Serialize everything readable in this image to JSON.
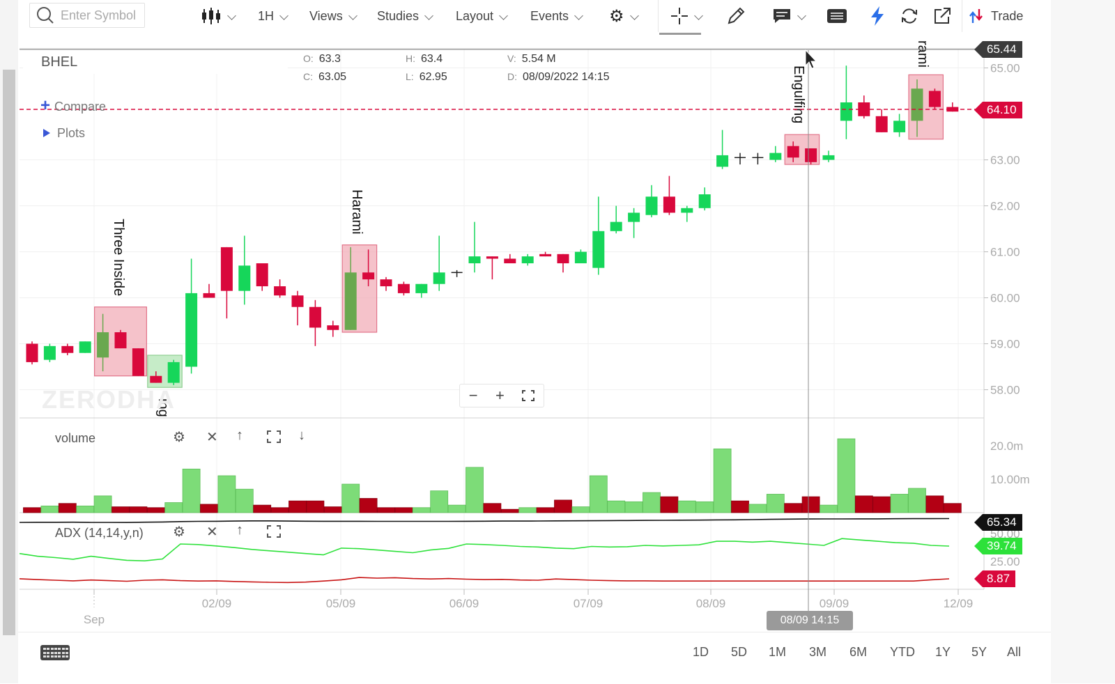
{
  "toolbar": {
    "search_placeholder": "Enter Symbol",
    "interval": "1H",
    "views": "Views",
    "studies": "Studies",
    "layout": "Layout",
    "events": "Events",
    "trade": "Trade"
  },
  "legend": {
    "symbol": "BHEL",
    "o_label": "O:",
    "o": "63.3",
    "h_label": "H:",
    "h": "63.4",
    "v_label": "V:",
    "v": "5.54 M",
    "c_label": "C:",
    "c": "63.05",
    "l_label": "L:",
    "l": "62.95",
    "d_label": "D:",
    "d": "08/09/2022 14:15",
    "compare": "Compare",
    "plots": "Plots"
  },
  "watermark": "ZERODHA",
  "panels": {
    "volume_label": "volume",
    "adx_label": "ADX (14,14,y,n)"
  },
  "price_tags": {
    "crosshair_price": "65.44",
    "last_price": "64.10",
    "adx_black": "65.34",
    "adx_green": "39.74",
    "adx_red": "8.87"
  },
  "crosshair_time": "08/09 14:15",
  "range_buttons": [
    "1D",
    "5D",
    "1M",
    "3M",
    "6M",
    "YTD",
    "1Y",
    "5Y",
    "All"
  ],
  "colors": {
    "up": "#16d65a",
    "down": "#d9083c",
    "vol_up": "#7ddc78",
    "vol_down": "#b30014",
    "adx_black": "#111111",
    "adx_green": "#2de13a",
    "adx_red": "#c81313",
    "pattern_fill": "#f2aeb8",
    "pattern_fill_green": "#b3e6b5"
  },
  "chart_data": {
    "type": "candlestick",
    "ylim": [
      57.5,
      65.6
    ],
    "y_ticks": [
      "65.00",
      "63.00",
      "62.00",
      "61.00",
      "60.00",
      "59.00",
      "58.00"
    ],
    "vol_ticks": [
      "20.0m",
      "10.00m"
    ],
    "adx_ticks": [
      "50.00",
      "25.00"
    ],
    "x_ticks": [
      "Sep",
      "02/09",
      "05/09",
      "06/09",
      "07/09",
      "08/09",
      "09/09",
      "12/09"
    ],
    "candles": [
      {
        "o": 59.0,
        "h": 59.05,
        "l": 58.55,
        "c": 58.6
      },
      {
        "o": 58.65,
        "h": 59.0,
        "l": 58.6,
        "c": 58.95
      },
      {
        "o": 58.95,
        "h": 59.0,
        "l": 58.75,
        "c": 58.8
      },
      {
        "o": 58.8,
        "h": 59.05,
        "l": 58.8,
        "c": 59.05
      },
      {
        "o": 58.7,
        "h": 59.65,
        "l": 58.4,
        "c": 59.25
      },
      {
        "o": 59.25,
        "h": 59.3,
        "l": 58.9,
        "c": 58.9
      },
      {
        "o": 58.9,
        "h": 58.9,
        "l": 58.3,
        "c": 58.3
      },
      {
        "o": 58.3,
        "h": 58.4,
        "l": 58.15,
        "c": 58.15
      },
      {
        "o": 58.15,
        "h": 58.65,
        "l": 58.1,
        "c": 58.6
      },
      {
        "o": 58.5,
        "h": 60.85,
        "l": 58.35,
        "c": 60.1
      },
      {
        "o": 60.1,
        "h": 60.3,
        "l": 60.0,
        "c": 60.0
      },
      {
        "o": 61.1,
        "h": 61.1,
        "l": 59.55,
        "c": 60.15
      },
      {
        "o": 60.15,
        "h": 61.35,
        "l": 59.85,
        "c": 60.7
      },
      {
        "o": 60.75,
        "h": 60.75,
        "l": 60.15,
        "c": 60.25
      },
      {
        "o": 60.25,
        "h": 60.4,
        "l": 60.0,
        "c": 60.05
      },
      {
        "o": 60.05,
        "h": 60.15,
        "l": 59.4,
        "c": 59.8
      },
      {
        "o": 59.8,
        "h": 59.95,
        "l": 58.95,
        "c": 59.35
      },
      {
        "o": 59.4,
        "h": 59.5,
        "l": 59.15,
        "c": 59.3
      },
      {
        "o": 59.3,
        "h": 61.1,
        "l": 59.3,
        "c": 60.55
      },
      {
        "o": 60.55,
        "h": 61.05,
        "l": 60.25,
        "c": 60.4
      },
      {
        "o": 60.4,
        "h": 60.45,
        "l": 60.15,
        "c": 60.25
      },
      {
        "o": 60.3,
        "h": 60.35,
        "l": 60.05,
        "c": 60.1
      },
      {
        "o": 60.1,
        "h": 60.3,
        "l": 60.0,
        "c": 60.3
      },
      {
        "o": 60.3,
        "h": 61.35,
        "l": 60.15,
        "c": 60.55
      },
      {
        "o": 60.55,
        "h": 60.6,
        "l": 60.45,
        "c": 60.55
      },
      {
        "o": 60.75,
        "h": 61.65,
        "l": 60.55,
        "c": 60.9
      },
      {
        "o": 60.9,
        "h": 60.9,
        "l": 60.4,
        "c": 60.85
      },
      {
        "o": 60.85,
        "h": 60.95,
        "l": 60.75,
        "c": 60.75
      },
      {
        "o": 60.75,
        "h": 60.95,
        "l": 60.7,
        "c": 60.9
      },
      {
        "o": 60.95,
        "h": 61.0,
        "l": 60.9,
        "c": 60.9
      },
      {
        "o": 60.95,
        "h": 60.95,
        "l": 60.55,
        "c": 60.75
      },
      {
        "o": 60.75,
        "h": 61.05,
        "l": 60.75,
        "c": 61.0
      },
      {
        "o": 60.65,
        "h": 62.2,
        "l": 60.5,
        "c": 61.45
      },
      {
        "o": 61.45,
        "h": 62.0,
        "l": 61.4,
        "c": 61.65
      },
      {
        "o": 61.65,
        "h": 61.95,
        "l": 61.3,
        "c": 61.85
      },
      {
        "o": 61.8,
        "h": 62.45,
        "l": 61.75,
        "c": 62.2
      },
      {
        "o": 62.2,
        "h": 62.65,
        "l": 61.8,
        "c": 61.85
      },
      {
        "o": 61.85,
        "h": 62.0,
        "l": 61.65,
        "c": 61.95
      },
      {
        "o": 61.95,
        "h": 62.4,
        "l": 61.9,
        "c": 62.25
      },
      {
        "o": 62.85,
        "h": 63.65,
        "l": 62.8,
        "c": 63.1
      },
      {
        "o": 63.05,
        "h": 63.15,
        "l": 62.9,
        "c": 63.05
      },
      {
        "o": 63.05,
        "h": 63.15,
        "l": 62.9,
        "c": 63.05
      },
      {
        "o": 63.0,
        "h": 63.3,
        "l": 62.95,
        "c": 63.15
      },
      {
        "o": 63.3,
        "h": 63.4,
        "l": 62.95,
        "c": 63.05
      },
      {
        "o": 63.25,
        "h": 63.25,
        "l": 62.9,
        "c": 62.95
      },
      {
        "o": 63.0,
        "h": 63.2,
        "l": 62.95,
        "c": 63.1
      },
      {
        "o": 63.85,
        "h": 65.05,
        "l": 63.45,
        "c": 64.25
      },
      {
        "o": 64.25,
        "h": 64.4,
        "l": 63.9,
        "c": 63.95
      },
      {
        "o": 63.95,
        "h": 64.1,
        "l": 63.6,
        "c": 63.6
      },
      {
        "o": 63.6,
        "h": 64.0,
        "l": 63.5,
        "c": 63.85
      },
      {
        "o": 63.85,
        "h": 64.75,
        "l": 63.5,
        "c": 64.55
      },
      {
        "o": 64.5,
        "h": 64.55,
        "l": 64.1,
        "c": 64.15
      },
      {
        "o": 64.15,
        "h": 64.25,
        "l": 64.05,
        "c": 64.05
      }
    ],
    "volume": [
      3.0,
      4.0,
      5.5,
      4.0,
      10.0,
      3.5,
      3.5,
      3.0,
      6.0,
      26.0,
      5.0,
      22.0,
      14.0,
      4.5,
      3.0,
      7.0,
      7.0,
      3.5,
      17.0,
      8.5,
      3.0,
      3.0,
      3.0,
      13.0,
      4.5,
      27.0,
      5.5,
      2.0,
      3.0,
      3.0,
      7.5,
      3.5,
      22.0,
      7.0,
      6.5,
      12.0,
      9.5,
      7.0,
      6.5,
      38.0,
      7.0,
      5.0,
      11.0,
      5.5,
      9.5,
      4.5,
      44.0,
      10.0,
      9.5,
      11.0,
      14.5,
      10.0,
      5.5
    ],
    "volume_up": [
      false,
      true,
      false,
      true,
      true,
      false,
      false,
      false,
      true,
      true,
      false,
      true,
      true,
      false,
      false,
      false,
      false,
      false,
      true,
      false,
      false,
      false,
      true,
      true,
      true,
      true,
      false,
      false,
      true,
      false,
      false,
      true,
      true,
      true,
      true,
      true,
      false,
      true,
      true,
      true,
      false,
      true,
      true,
      false,
      false,
      true,
      true,
      false,
      false,
      true,
      true,
      false,
      false
    ],
    "adx": {
      "black": [
        61.5,
        61.6,
        61.6,
        61.7,
        61.5,
        61.5,
        61.4,
        61.7,
        61.9,
        62.3,
        62.5,
        62.6,
        62.8,
        63.0,
        63.0,
        62.8,
        62.7,
        62.6,
        62.6,
        62.6,
        62.5,
        62.5,
        62.5,
        62.5,
        62.5,
        62.6,
        62.7,
        62.8,
        62.8,
        62.9,
        63.0,
        63.1,
        63.2,
        63.3,
        63.4,
        63.5,
        63.6,
        63.7,
        63.8,
        64.0,
        64.1,
        64.3,
        64.6,
        64.8,
        64.9,
        65.0,
        65.0,
        65.1,
        65.1,
        65.2,
        65.3,
        65.3,
        65.34
      ],
      "green": [
        37.0,
        36.0,
        35.5,
        34.9,
        36.0,
        35.2,
        34.5,
        34.3,
        35.0,
        40.5,
        40.3,
        39.8,
        39.2,
        38.5,
        38.0,
        37.5,
        37.0,
        36.5,
        39.0,
        38.8,
        38.3,
        37.8,
        37.3,
        38.3,
        38.9,
        40.5,
        40.3,
        40.0,
        39.6,
        39.4,
        39.0,
        38.8,
        39.6,
        39.4,
        39.5,
        40.0,
        39.8,
        40.0,
        40.2,
        41.5,
        41.5,
        41.2,
        41.5,
        41.0,
        40.5,
        40.0,
        42.5,
        42.0,
        41.5,
        41.0,
        40.8,
        40.0,
        39.74
      ]
    }
  },
  "patterns": [
    {
      "label": "Three Inside",
      "from": 4,
      "to": 6,
      "lo": 58.3,
      "hi": 59.8,
      "kind": "down"
    },
    {
      "label": "ing",
      "from": 7,
      "to": 8,
      "lo": 58.05,
      "hi": 58.75,
      "kind": "up"
    },
    {
      "label": "Harami",
      "from": 18,
      "to": 19,
      "lo": 59.25,
      "hi": 61.15,
      "kind": "down"
    },
    {
      "label": "Engulfing",
      "from": 43,
      "to": 44,
      "lo": 62.9,
      "hi": 63.55,
      "kind": "down"
    },
    {
      "label": "rami",
      "from": 50,
      "to": 51,
      "lo": 63.45,
      "hi": 64.85,
      "kind": "down"
    }
  ]
}
